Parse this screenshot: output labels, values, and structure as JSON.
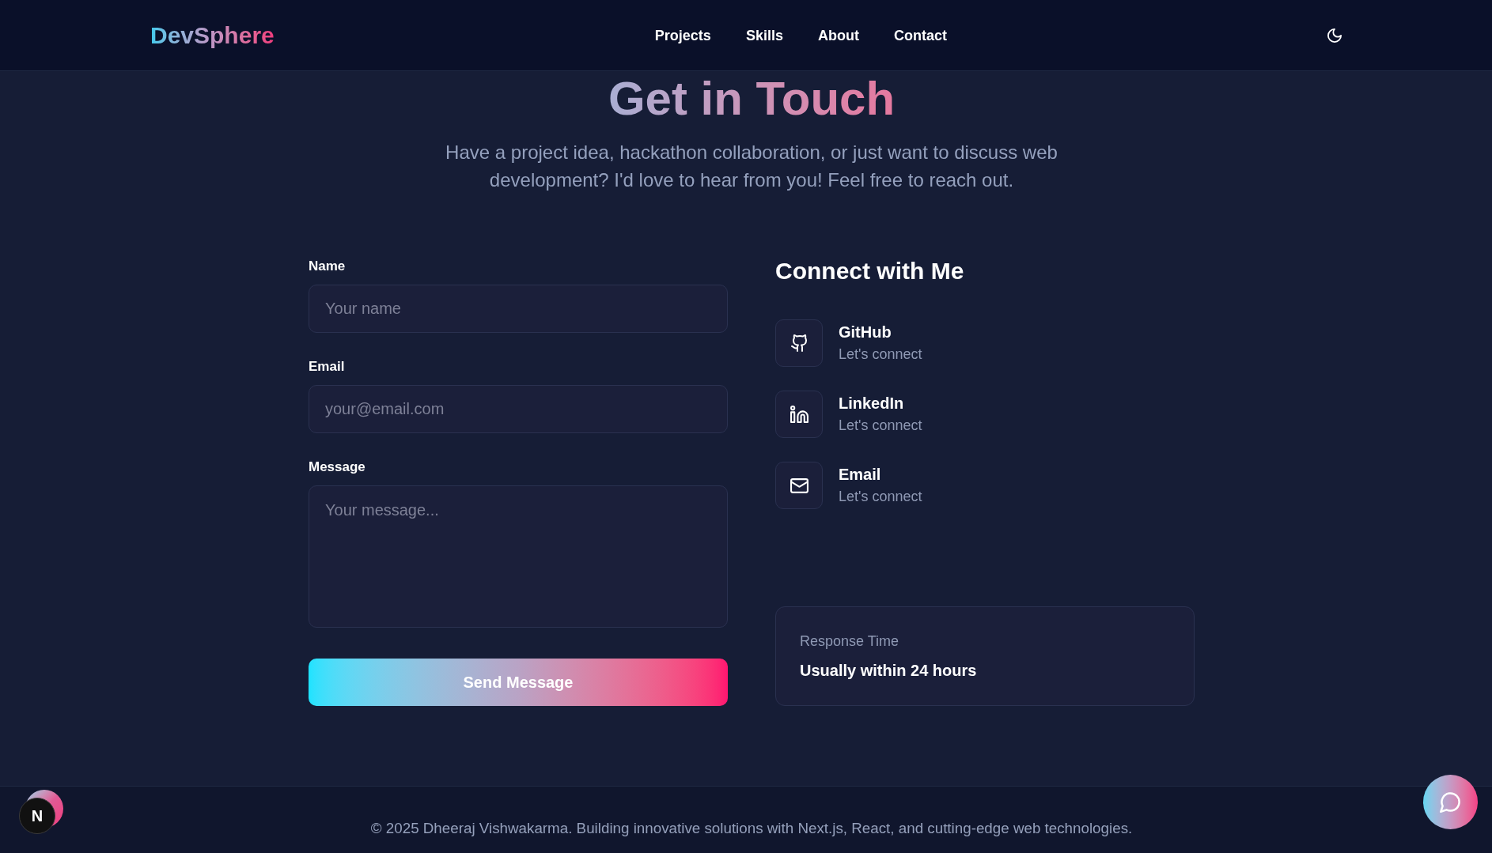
{
  "header": {
    "logo": "DevSphere",
    "nav": [
      {
        "label": "Projects"
      },
      {
        "label": "Skills"
      },
      {
        "label": "About"
      },
      {
        "label": "Contact"
      }
    ]
  },
  "hero": {
    "title": "Get in Touch",
    "subtitle": "Have a project idea, hackathon collaboration, or just want to discuss web development? I'd love to hear from you! Feel free to reach out."
  },
  "contact_form": {
    "fields": [
      {
        "kind": "input",
        "label": "Name",
        "placeholder": "Your name"
      },
      {
        "kind": "input",
        "label": "Email",
        "placeholder": "your@email.com"
      },
      {
        "kind": "textarea",
        "label": "Message",
        "placeholder": "Your message..."
      }
    ],
    "submit_button": "Send Message"
  },
  "connect": {
    "title": "Connect with Me",
    "links": [
      {
        "kind": "github",
        "title": "GitHub",
        "subtitle": "Let's connect"
      },
      {
        "kind": "linkedin",
        "title": "LinkedIn",
        "subtitle": "Let's connect"
      },
      {
        "kind": "email",
        "title": "Email",
        "subtitle": "Let's connect"
      }
    ]
  },
  "response_card": {
    "label": "Response Time",
    "value": "Usually within 24 hours"
  },
  "footer": {
    "text": "© 2025 Dheeraj Vishwakarma. Building innovative solutions with Next.js, React, and cutting-edge web technologies."
  },
  "dev_badge": {
    "label": "N"
  }
}
